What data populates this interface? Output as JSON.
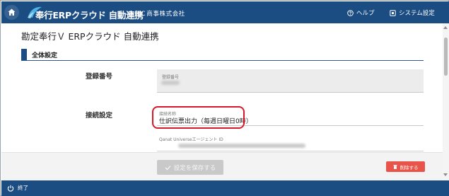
{
  "header": {
    "app_name": "奉行ERPクラウド 自動連携",
    "company_name": "ＯＢＣ商事株式会社",
    "help_label": "ヘルプ",
    "system_settings_label": "システム設定"
  },
  "page": {
    "title": "勘定奉行Ｖ ERPクラウド 自動連携"
  },
  "section": {
    "label": "全体設定"
  },
  "registration": {
    "row_label": "登録番号",
    "field_caption": "登録番号"
  },
  "connection": {
    "row_label": "接続設定",
    "name_caption": "接続名称",
    "name_value": "仕訳伝票出力（毎週日曜日0時）",
    "agent_caption": "Qanat Universeエージェント ID"
  },
  "actions": {
    "save_label": "設定を保存する",
    "delete_label": "削除する"
  },
  "footer": {
    "exit_label": "終了"
  },
  "colors": {
    "header_bg": "#1c4d82",
    "highlight_border": "#d9192a",
    "delete_button": "#e8534a",
    "save_button_disabled": "#c9c9c9"
  }
}
